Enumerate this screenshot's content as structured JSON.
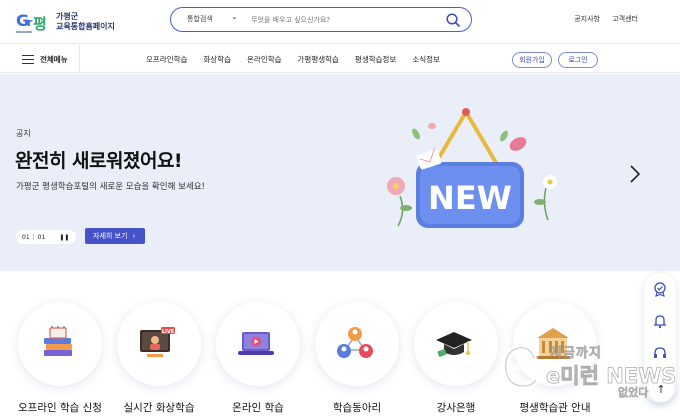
{
  "header": {
    "logo_text_line1": "가평군",
    "logo_text_line2": "교육통합홈페이지",
    "search": {
      "category": "통합검색",
      "placeholder": "무엇을 배우고 싶으신가요?"
    },
    "links": [
      "공지사항",
      "고객센터"
    ]
  },
  "nav": {
    "all_menu": "전체메뉴",
    "items": [
      "오프라인학습",
      "화상학습",
      "온라인학습",
      "가평평생학습",
      "평생학습정보",
      "소식정보"
    ],
    "join": "회원가입",
    "login": "로그인"
  },
  "hero": {
    "kicker": "공지",
    "title": "완전히 새로워졌어요!",
    "subtitle": "가평군 평생학습포털의 새로운 모습을 확인해 보세요!",
    "pager_current": "01",
    "pager_total": "01",
    "detail_button": "자세히 보기",
    "badge_text": "NEW"
  },
  "services": [
    {
      "label": "오프라인 학습 신청",
      "icon": "books-icon"
    },
    {
      "label": "실시간 화상학습",
      "icon": "live-stream-icon"
    },
    {
      "label": "온라인 학습",
      "icon": "laptop-play-icon"
    },
    {
      "label": "학습동아리",
      "icon": "people-network-icon"
    },
    {
      "label": "강사은행",
      "icon": "graduation-cap-icon"
    },
    {
      "label": "평생학습관 안내",
      "icon": "building-icon"
    }
  ],
  "floating": [
    "badge-icon",
    "bell-icon",
    "headset-icon"
  ],
  "watermark": {
    "top": "지금까지",
    "main": "e미런 NEWS",
    "bottom": "없었다"
  },
  "colors": {
    "accent": "#4653c8",
    "hero_bg": "#e9eef9",
    "badge_blue": "#5b7fe0"
  }
}
